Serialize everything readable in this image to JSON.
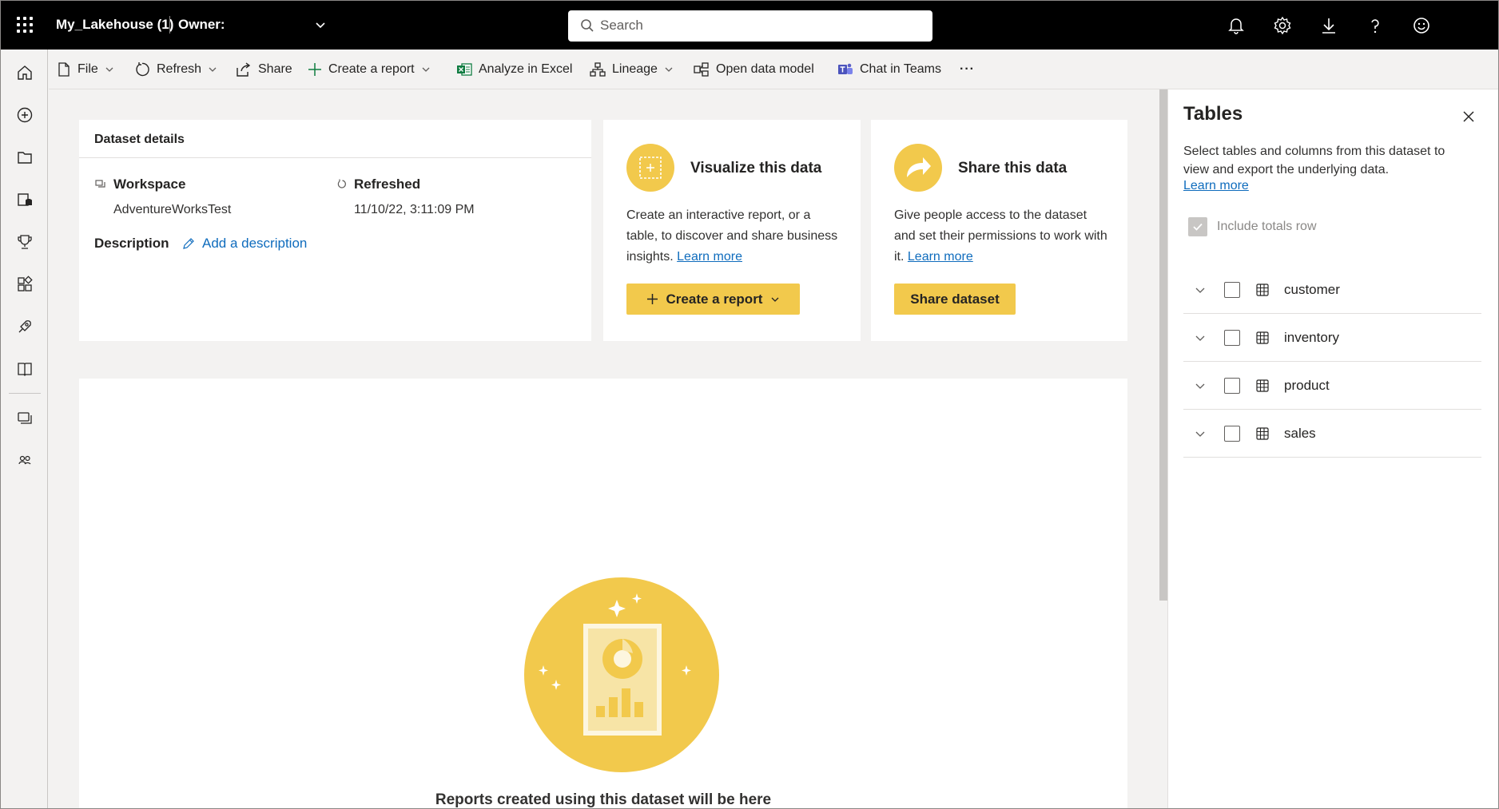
{
  "topbar": {
    "app_title": "My_Lakehouse (1)",
    "owner_label": "Owner:",
    "search_placeholder": "Search",
    "icons": [
      "bell-icon",
      "gear-icon",
      "download-icon",
      "help-icon",
      "smiley-icon"
    ]
  },
  "leftrail": {
    "icons": [
      "home-icon",
      "create-icon",
      "browse-icon",
      "datahub-icon",
      "goals-icon",
      "apps-icon",
      "deployment-icon",
      "learn-icon",
      "workspaces-icon",
      "people-icon"
    ]
  },
  "commandbar": {
    "file": "File",
    "refresh": "Refresh",
    "share": "Share",
    "create_report": "Create a report",
    "analyze_excel": "Analyze in Excel",
    "lineage": "Lineage",
    "open_data_model": "Open data model",
    "chat_teams": "Chat in Teams",
    "more": "···"
  },
  "details": {
    "header": "Dataset details",
    "workspace_label": "Workspace",
    "workspace_value": "AdventureWorksTest",
    "refreshed_label": "Refreshed",
    "refreshed_value": "11/10/22, 3:11:09 PM",
    "description_label": "Description",
    "add_description": "Add a description"
  },
  "visualize": {
    "title": "Visualize this data",
    "desc": "Create an interactive report, or a table, to discover and share business insights.",
    "learn_more": "Learn more",
    "button": "Create a report"
  },
  "share": {
    "title": "Share this data",
    "desc": "Give people access to the dataset and set their permissions to work with it.",
    "learn_more": "Learn more",
    "button": "Share dataset"
  },
  "reports": {
    "empty_text": "Reports created using this dataset will be here"
  },
  "panel": {
    "title": "Tables",
    "desc": "Select tables and columns from this dataset to view and export the underlying data.",
    "learn_more": "Learn more",
    "include_totals": "Include totals row",
    "tables": [
      {
        "name": "customer"
      },
      {
        "name": "inventory"
      },
      {
        "name": "product"
      },
      {
        "name": "sales"
      }
    ]
  },
  "colors": {
    "accent_yellow": "#F2C94C",
    "link_blue": "#0F6CBD",
    "topbar_bg": "#000000"
  }
}
